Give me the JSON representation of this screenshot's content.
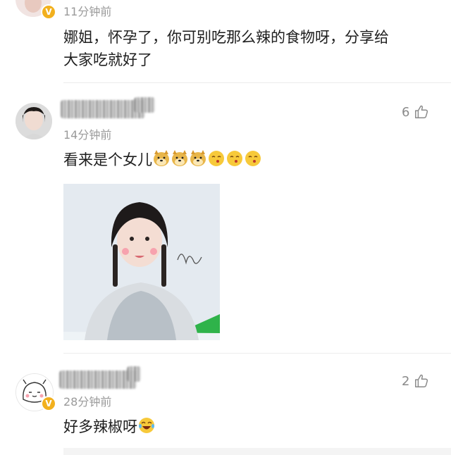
{
  "comments": [
    {
      "time": "11分钟前",
      "text_line1": "娜姐，怀孕了，你可别吃那么辣的食物呀，分享给",
      "text_line2": "大家吃就好了"
    },
    {
      "time": "14分钟前",
      "text": "看来是个女儿",
      "like_count": "6",
      "emojis": [
        "doge-icon",
        "doge-icon",
        "doge-icon",
        "kiss-icon",
        "kiss-icon",
        "kiss-icon"
      ]
    },
    {
      "time": "28分钟前",
      "text": "好多辣椒呀",
      "like_count": "2",
      "emojis": [
        "laugh-tears-icon"
      ]
    }
  ],
  "colors": {
    "badge": "#f2b01e",
    "accent_green": "#2fb34a"
  }
}
